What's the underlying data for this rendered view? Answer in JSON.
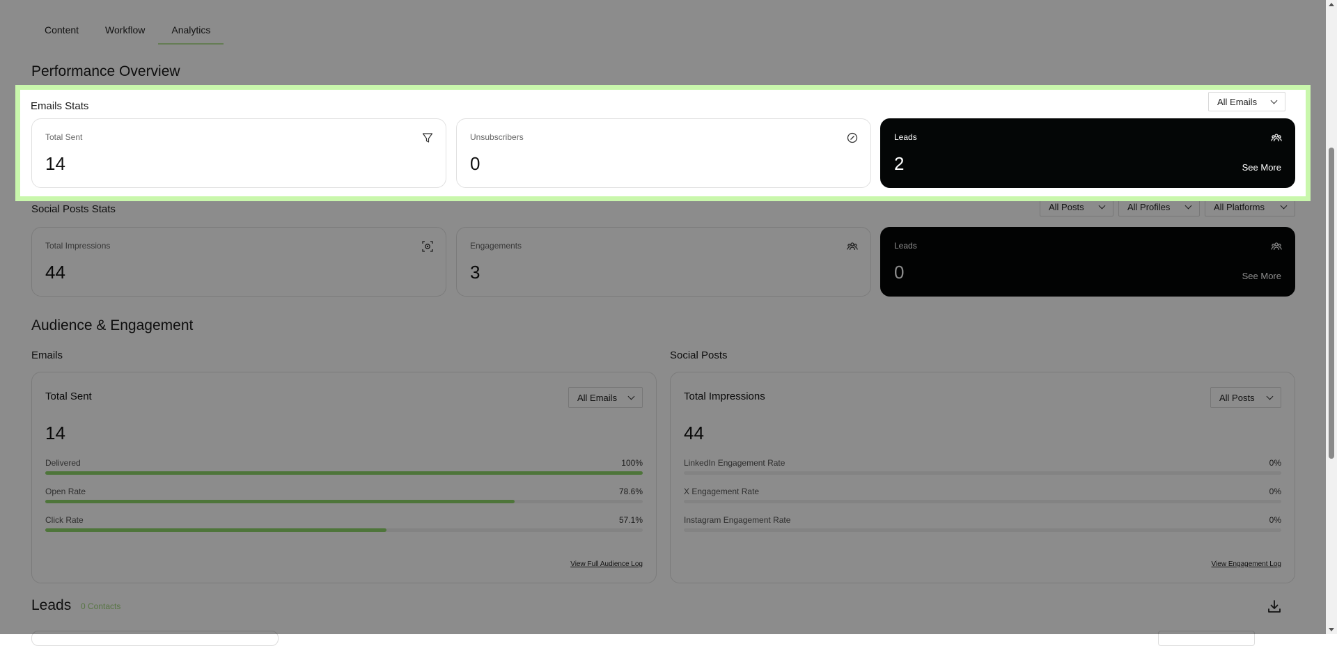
{
  "tabs": [
    {
      "label": "Content"
    },
    {
      "label": "Workflow"
    },
    {
      "label": "Analytics"
    }
  ],
  "performance": {
    "title": "Performance Overview",
    "emails_stats": {
      "title": "Emails Stats",
      "filter": "All Emails",
      "cards": [
        {
          "label": "Total Sent",
          "value": "14",
          "icon": "send-icon"
        },
        {
          "label": "Unsubscribers",
          "value": "0",
          "icon": "block-icon"
        },
        {
          "label": "Leads",
          "value": "2",
          "icon": "users-icon",
          "see_more": "See More"
        }
      ]
    },
    "social_stats": {
      "title": "Social Posts Stats",
      "filters": [
        "All Posts",
        "All Profiles",
        "All Platforms"
      ],
      "cards": [
        {
          "label": "Total Impressions",
          "value": "44",
          "icon": "impressions-icon"
        },
        {
          "label": "Engagements",
          "value": "3",
          "icon": "users-icon"
        },
        {
          "label": "Leads",
          "value": "0",
          "icon": "users-icon",
          "see_more": "See More"
        }
      ]
    }
  },
  "audience": {
    "title": "Audience & Engagement",
    "emails": {
      "heading": "Emails",
      "panel_title": "Total Sent",
      "filter": "All Emails",
      "value": "14",
      "metrics": [
        {
          "label": "Delivered",
          "value": "100%",
          "fraction": 1.0
        },
        {
          "label": "Open Rate",
          "value": "78.6%",
          "fraction": 0.786
        },
        {
          "label": "Click Rate",
          "value": "57.1%",
          "fraction": 0.571
        }
      ],
      "link": "View Full Audience Log"
    },
    "social": {
      "heading": "Social Posts",
      "panel_title": "Total Impressions",
      "filter": "All Posts",
      "value": "44",
      "metrics": [
        {
          "label": "LinkedIn Engagement Rate",
          "value": "0%",
          "fraction": 0
        },
        {
          "label": "X Engagement Rate",
          "value": "0%",
          "fraction": 0
        },
        {
          "label": "Instagram Engagement Rate",
          "value": "0%",
          "fraction": 0
        }
      ],
      "link": "View Engagement Log"
    }
  },
  "leads": {
    "title": "Leads",
    "count": "0 Contacts"
  },
  "colors": {
    "accent": "#8fd66a",
    "highlight": "#c9f7ac",
    "dark_card": "#040606"
  }
}
